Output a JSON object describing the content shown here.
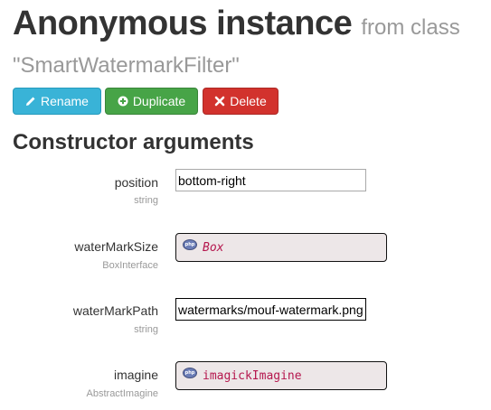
{
  "header": {
    "title": "Anonymous instance",
    "from_text": "from class",
    "class_name": "\"SmartWatermarkFilter\""
  },
  "toolbar": {
    "rename_label": "Rename",
    "duplicate_label": "Duplicate",
    "delete_label": "Delete",
    "rename_color": "#39b3d7",
    "duplicate_color": "#47a447",
    "delete_color": "#d2322d"
  },
  "section": {
    "heading": "Constructor arguments"
  },
  "arguments": [
    {
      "name": "position",
      "type": "string",
      "kind": "text",
      "value": "bottom-right"
    },
    {
      "name": "waterMarkSize",
      "type": "BoxInterface",
      "kind": "reference",
      "value": "Box"
    },
    {
      "name": "waterMarkPath",
      "type": "string",
      "kind": "text",
      "value": "watermarks/mouf-watermark.png"
    },
    {
      "name": "imagine",
      "type": "AbstractImagine",
      "kind": "reference",
      "value": "imagickImagine"
    }
  ],
  "icons": {
    "rename": "pencil-icon",
    "duplicate": "plus-circle-icon",
    "delete": "x-icon",
    "reference": "php-icon"
  }
}
